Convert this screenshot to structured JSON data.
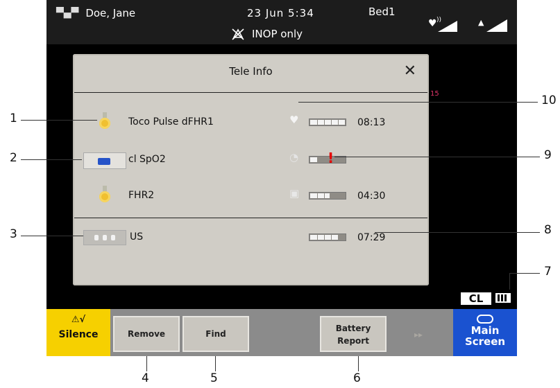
{
  "header": {
    "patient_name": "Doe, Jane",
    "date_time": "23  Jun   5:34",
    "bed": "Bed1",
    "alarm_status": "INOP only"
  },
  "dialog": {
    "title": "Tele Info",
    "close_glyph": "✕",
    "red_label": "15",
    "rows": [
      {
        "name": "Toco Pulse dFHR1",
        "time": "08:13",
        "icon": "transducer-medal-icon"
      },
      {
        "name": "cl SpO2",
        "time": "",
        "icon": "spo2-device-icon"
      },
      {
        "name": "FHR2",
        "time": "04:30",
        "icon": "transducer-medal-icon"
      },
      {
        "name": "US",
        "time": "07:29",
        "icon": "us-transducer-icon"
      }
    ],
    "warning_glyph": "!"
  },
  "status": {
    "cl_label": "CL"
  },
  "toolbar": {
    "silence_label": "Silence",
    "silence_glyph": "⚠√",
    "remove_label": "Remove",
    "find_label": "Find",
    "battery_report_line1": "Battery",
    "battery_report_line2": "Report",
    "next_glyph": "▸▸",
    "main_screen_line1": "Main",
    "main_screen_line2": "Screen"
  },
  "callouts": {
    "c1": "1",
    "c2": "2",
    "c3": "3",
    "c4": "4",
    "c5": "5",
    "c6": "6",
    "c7": "7",
    "c8": "8",
    "c9": "9",
    "c10": "10"
  },
  "colors": {
    "silence_yellow": "#f6d000",
    "main_screen_blue": "#1a52d0",
    "warning_red": "#e60000",
    "dialog_bg": "#d0cdc6"
  }
}
